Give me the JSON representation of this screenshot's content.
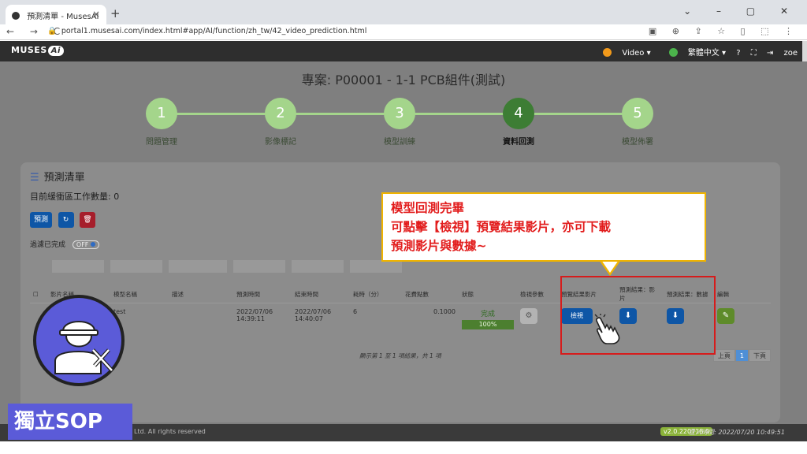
{
  "browser": {
    "tab_title": "預測清單 - MusesAI",
    "tab_close": "×",
    "new_tab": "+",
    "window_controls": "⌄ – ▢ ✕",
    "nav_buttons": "← → C",
    "url": "portal1.musesai.com/index.html#app/AI/function/zh_tw/42_video_prediction.html",
    "address_icons": "▣ ⊕ ⇪ ☆ ▯ ⬚ ⋮"
  },
  "header": {
    "logo_text": "MUSES",
    "logo_ai": "Ai",
    "video_label": "Video",
    "lang_label": "繁體中文",
    "help_icon": "?",
    "expand_icon": "⛶",
    "logout_icon": "⇥",
    "user": "zoe"
  },
  "project_title": "專案: P00001 - 1-1 PCB組件(測試)",
  "steps": [
    {
      "num": "1",
      "label": "問題管理"
    },
    {
      "num": "2",
      "label": "影像標記"
    },
    {
      "num": "3",
      "label": "模型訓練"
    },
    {
      "num": "4",
      "label": "資料回測"
    },
    {
      "num": "5",
      "label": "模型佈署"
    }
  ],
  "card": {
    "title": "預測清單",
    "queue": "目前緩衝區工作數量: 0",
    "btn_predict": "預測",
    "btn_refresh": "↻",
    "btn_delete": "🗑",
    "filter_label": "過濾已完成",
    "toggle": "OFF"
  },
  "table": {
    "headers": [
      "",
      "影片名稱",
      "模型名稱",
      "描述",
      "預測時間",
      "結束時間",
      "耗時（分）",
      "花費點數",
      "狀態",
      "檢視參數",
      "預覽結果影片",
      "預測結果：影片",
      "預測結果：數據",
      "編輯"
    ],
    "row": {
      "model": "test",
      "predict_time": "2022/07/06 14:39:11",
      "end_time": "2022/07/06 14:40:07",
      "duration": "6",
      "cost": "0.1000",
      "status": "完成",
      "progress": "100%",
      "view_btn": "檢視"
    },
    "progress_value": 100,
    "info": "顯示第 1 至 1 項結果，共 1 項",
    "pager_prev": "上頁",
    "pager_current": "1",
    "pager_next": "下頁"
  },
  "callout": {
    "line1": "模型回測完畢",
    "line2": "可點擊【檢視】預覽結果影片，亦可下載",
    "line3": "預測影片與數據~"
  },
  "footer": {
    "copyright": "Ltd. All rights reserved",
    "version": "v2.0.220718.0",
    "login": "登入時間: 2022/07/20 10:49:51"
  },
  "badge": {
    "label": "獨立SOP"
  },
  "colors": {
    "accent_blue": "#0e56a6",
    "step_green": "#a4d58b",
    "step_active": "#3d7d34",
    "callout_red": "#e21c1c",
    "callout_border": "#f0b400",
    "badge_purple": "#5b5bd8"
  }
}
